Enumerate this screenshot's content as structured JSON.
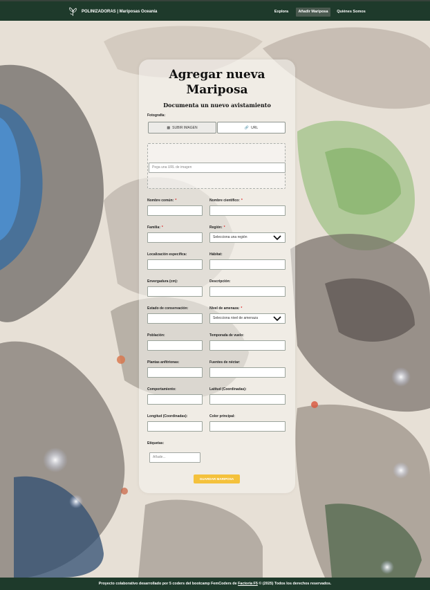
{
  "colors": {
    "nav_bg": "#1e3a2b",
    "accent_button": "#f4c13c",
    "required_mark": "#dd2222"
  },
  "navbar": {
    "logo_icon": "butterfly-leaf-icon",
    "brand": "POLINIZADORAS | Mariposas Oceanía",
    "links": [
      {
        "label": "Explora",
        "active": false
      },
      {
        "label": "Añadir Mariposa",
        "active": true
      },
      {
        "label": "Quiénes Somos",
        "active": false
      }
    ]
  },
  "form": {
    "title": "Agregar nueva Mariposa",
    "subtitle": "Documenta un nuevo avistamiento",
    "photo_label": "Fotografía:",
    "upload_button": {
      "icon": "camera-icon",
      "label": "SUBIR IMAGEN"
    },
    "url_button": {
      "icon": "link-icon",
      "label": "URL"
    },
    "url_placeholder": "Pega una URL de imagen",
    "fields": {
      "common_name": {
        "label": "Nombre común:",
        "required": true
      },
      "scientific_name": {
        "label": "Nombre científico:",
        "required": true
      },
      "family": {
        "label": "Familia:",
        "required": true
      },
      "region": {
        "label": "Región:",
        "required": true,
        "selected": "Selecciona una región"
      },
      "locality": {
        "label": "Localización específica:"
      },
      "habitat": {
        "label": "Hábitat:"
      },
      "wingspan": {
        "label": "Envergadura (cm):"
      },
      "description": {
        "label": "Descripción:"
      },
      "conservation": {
        "label": "Estado de conservación:"
      },
      "threat_level": {
        "label": "Nivel de amenaza:",
        "required": true,
        "selected": "Selecciona nivel de amenaza"
      },
      "population": {
        "label": "Población:"
      },
      "flight_season": {
        "label": "Temporada de vuelo:"
      },
      "host_plants": {
        "label": "Plantas anfitrionas:"
      },
      "nectar_sources": {
        "label": "Fuentes de néctar:"
      },
      "behavior": {
        "label": "Comportamiento:"
      },
      "latitude": {
        "label": "Latitud (Coordinadas):"
      },
      "longitude": {
        "label": "Longitud (Coordinadas):"
      },
      "main_color": {
        "label": "Color principal:"
      },
      "tags": {
        "label": "Etiquetas:",
        "placeholder": "Añade..."
      }
    },
    "required_mark": "*",
    "submit_label": "GUARDAR MARIPOSA"
  },
  "footer": {
    "text_before": "Proyecto colaborativo desarrollado por 5 coders del bootcamp FemCoders de ",
    "link": "Factoría F5",
    "text_after": " © (2025) Todos los derechos reservados."
  }
}
